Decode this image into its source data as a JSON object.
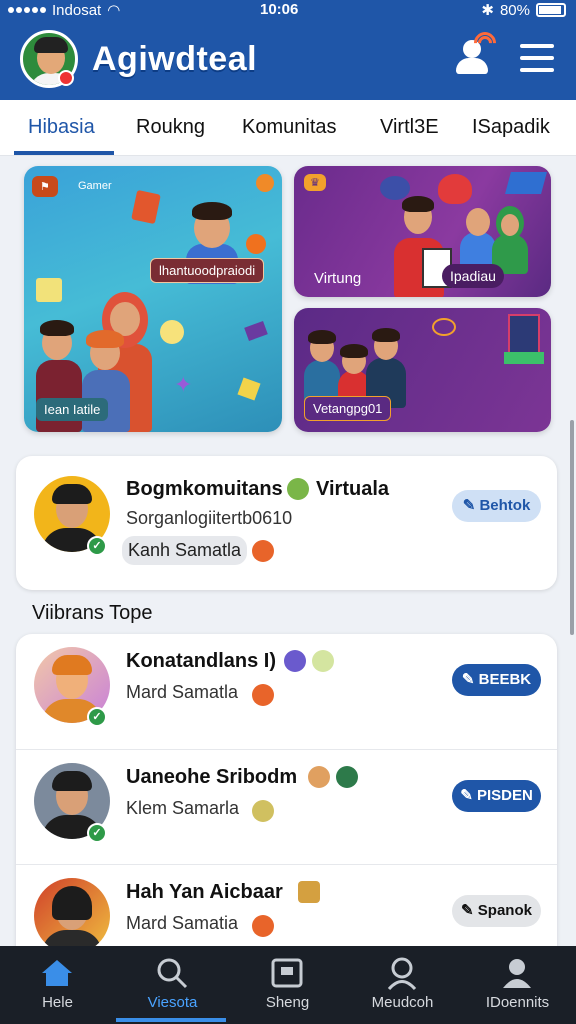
{
  "status_bar": {
    "carrier": "Indosat",
    "time": "10:06",
    "battery": "80%"
  },
  "header": {
    "app_title": "Agiwdteal"
  },
  "tabs": [
    {
      "label": "Hibasia",
      "active": true
    },
    {
      "label": "Roukng",
      "active": false
    },
    {
      "label": "Komunitas",
      "active": false
    },
    {
      "label": "Virtl3E",
      "active": false
    },
    {
      "label": "ISapadik",
      "active": false
    }
  ],
  "banners": {
    "main": {
      "corner_label": "Gamer",
      "caption": "lhantuoodpraiodi",
      "footer": "Iean Iatile"
    },
    "top_right": {
      "caption": "Virtung",
      "button": "Ipadiau"
    },
    "bottom_right": {
      "caption": "Vetangpg01"
    }
  },
  "featured": {
    "name": "Bogmkomuitans",
    "name_suffix": "Virtuala",
    "subtitle": "Sorganlogiitertb0610",
    "chip": "Kanh Samatla",
    "button": "Behtok"
  },
  "section": {
    "title": "Viibrans Tope"
  },
  "list": [
    {
      "name": "Konatandlans I)",
      "sub": "Mard Samatla",
      "button": "BEEBK"
    },
    {
      "name": "Uaneohe Sribodm",
      "sub": "Klem Samarla",
      "button": "PISDEN"
    },
    {
      "name": "Hah Yan Aicbaar",
      "sub": "Mard Samatia",
      "button": "Spanok"
    }
  ],
  "bottom_nav": [
    {
      "label": "Hele",
      "icon": "home-icon",
      "active": false
    },
    {
      "label": "Viesota",
      "icon": "search-icon",
      "active": true
    },
    {
      "label": "Sheng",
      "icon": "shop-icon",
      "active": false
    },
    {
      "label": "Meudcoh",
      "icon": "person-search-icon",
      "active": false
    },
    {
      "label": "IDoennits",
      "icon": "account-icon",
      "active": false
    }
  ],
  "colors": {
    "brand": "#1f56a8",
    "verified": "#2e9a48",
    "banner_purple": "#7c3595",
    "banner_teal": "#46bcd6"
  }
}
